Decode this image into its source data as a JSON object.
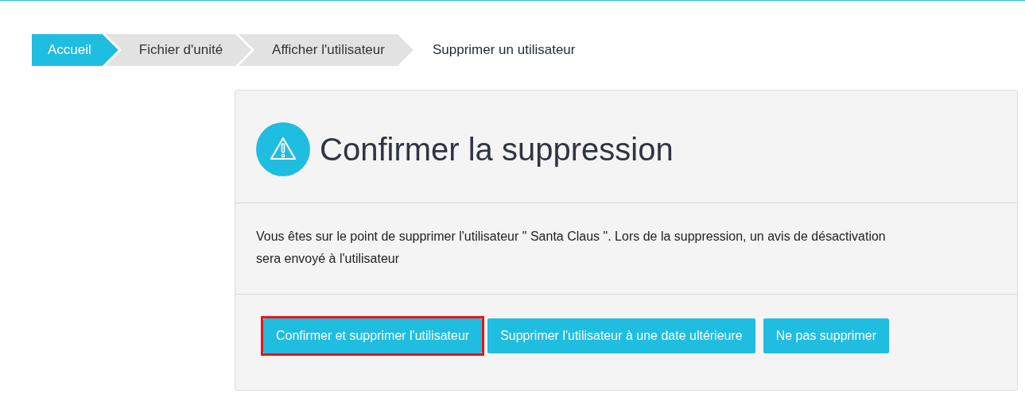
{
  "breadcrumb": [
    {
      "label": "Accueil",
      "kind": "home"
    },
    {
      "label": "Fichier d'unité",
      "kind": "link"
    },
    {
      "label": "Afficher l'utilisateur",
      "kind": "link"
    },
    {
      "label": "Supprimer un utilisateur",
      "kind": "current"
    }
  ],
  "dialog": {
    "title": "Confirmer la suppression",
    "message": "Vous êtes sur le point de supprimer l'utilisateur \" Santa Claus \". Lors de la suppression, un avis de désactivation sera envoyé à l'utilisateur",
    "buttons": [
      {
        "label": "Confirmer et supprimer l'utilisateur",
        "highlighted": true
      },
      {
        "label": "Supprimer l'utilisateur à une date ultérieure",
        "highlighted": false
      },
      {
        "label": "Ne pas supprimer",
        "highlighted": false
      }
    ]
  }
}
